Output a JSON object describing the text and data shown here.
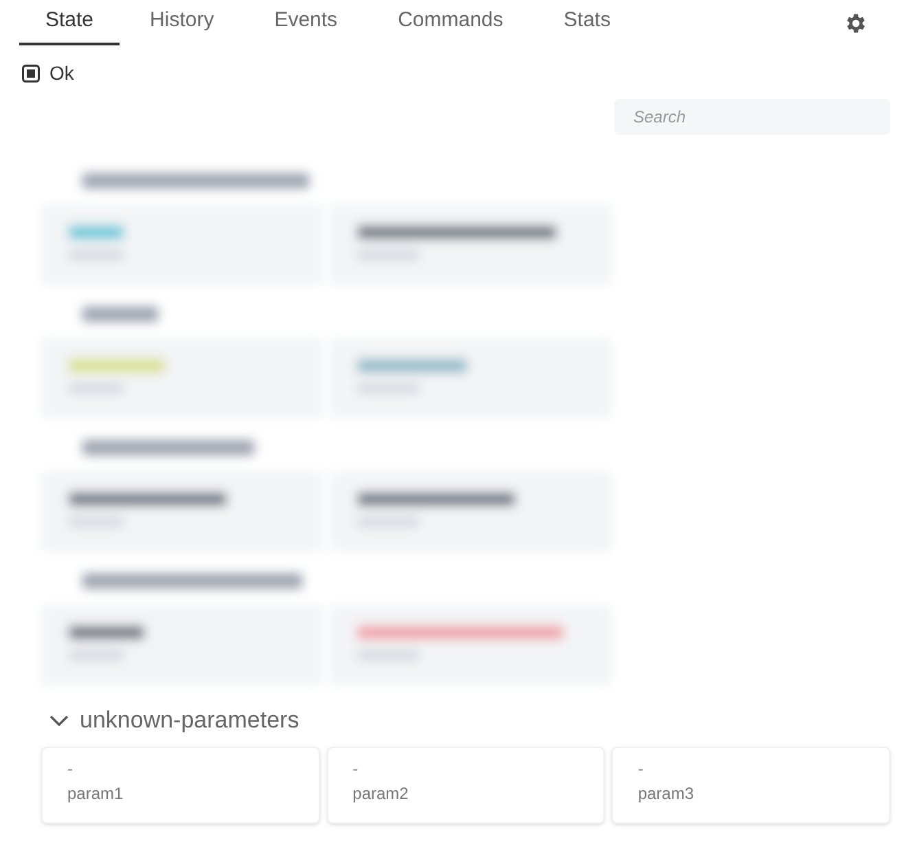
{
  "tabs": [
    {
      "label": "State",
      "selected": true
    },
    {
      "label": "History",
      "selected": false
    },
    {
      "label": "Events",
      "selected": false
    },
    {
      "label": "Commands",
      "selected": false
    },
    {
      "label": "Stats",
      "selected": false
    }
  ],
  "status": {
    "label": "Ok"
  },
  "search": {
    "placeholder": "Search"
  },
  "section": {
    "title": "unknown-parameters",
    "expanded": true,
    "params": [
      {
        "value": "-",
        "name": "param1"
      },
      {
        "value": "-",
        "name": "param2"
      },
      {
        "value": "-",
        "name": "param3"
      }
    ]
  }
}
